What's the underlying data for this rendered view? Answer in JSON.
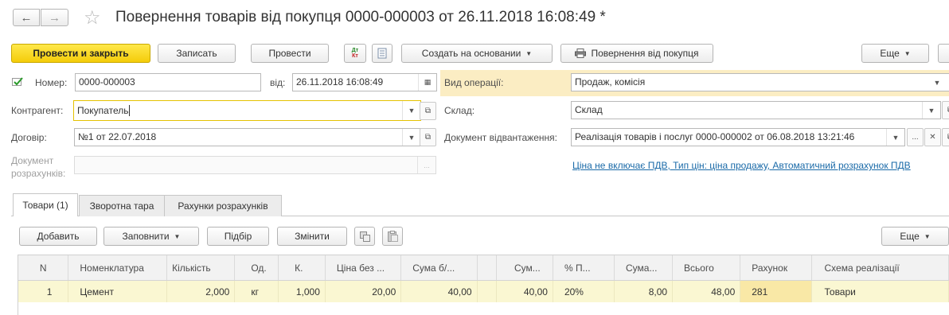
{
  "window": {
    "title": "Повернення товарів від покупця 0000-000003 от 26.11.2018 16:08:49 *"
  },
  "nav": {
    "back": "←",
    "forward": "→",
    "star": "☆"
  },
  "toolbar": {
    "post_close": "Провести и закрыть",
    "write": "Записать",
    "post": "Провести",
    "create_based": "Создать на основании",
    "return_print": "Повернення від покупця",
    "more": "Еще"
  },
  "form": {
    "number_label": "Номер:",
    "number_value": "0000-000003",
    "date_label": "від:",
    "date_value": "26.11.2018 16:08:49",
    "contractor_label": "Контрагент:",
    "contractor_value": "Покупатель",
    "contract_label": "Договір:",
    "contract_value": "№1 от 22.07.2018",
    "settlement_label_1": "Документ",
    "settlement_label_2": "розрахунків:",
    "settlement_value": "",
    "operation_label": "Вид операції:",
    "operation_value": "Продаж, комісія",
    "warehouse_label": "Склад:",
    "warehouse_value": "Склад",
    "shipment_label": "Документ відвантаження:",
    "shipment_value": "Реалізація товарів і послуг 0000-000002 от 06.08.2018 13:21:46",
    "price_link": "Ціна не включає ПДВ, Тип цін: ціна продажу, Автоматичний розрахунок ПДВ"
  },
  "tabs": [
    "Товари (1)",
    "Зворотна тара",
    "Рахунки розрахунків"
  ],
  "table_toolbar": {
    "add": "Добавить",
    "fill": "Заповнити",
    "select": "Підбір",
    "change": "Змінити",
    "more": "Еще"
  },
  "table": {
    "columns": [
      "N",
      "Номенклатура",
      "Кількість",
      "Од.",
      "К.",
      "Ціна без ...",
      "Сума б/...",
      "",
      "Сум...",
      "% П...",
      "Сума...",
      "Всього",
      "Рахунок",
      "Схема реалізації"
    ],
    "rows": [
      [
        "1",
        "Цемент",
        "2,000",
        "кг",
        "1,000",
        "20,00",
        "40,00",
        "",
        "40,00",
        "20%",
        "8,00",
        "48,00",
        "281",
        "Товари"
      ]
    ]
  },
  "colors": {
    "primary_button": "#f4cc0a",
    "highlight": "#fbedc3",
    "link": "#1a6aa8",
    "row": "#faf7d2"
  }
}
